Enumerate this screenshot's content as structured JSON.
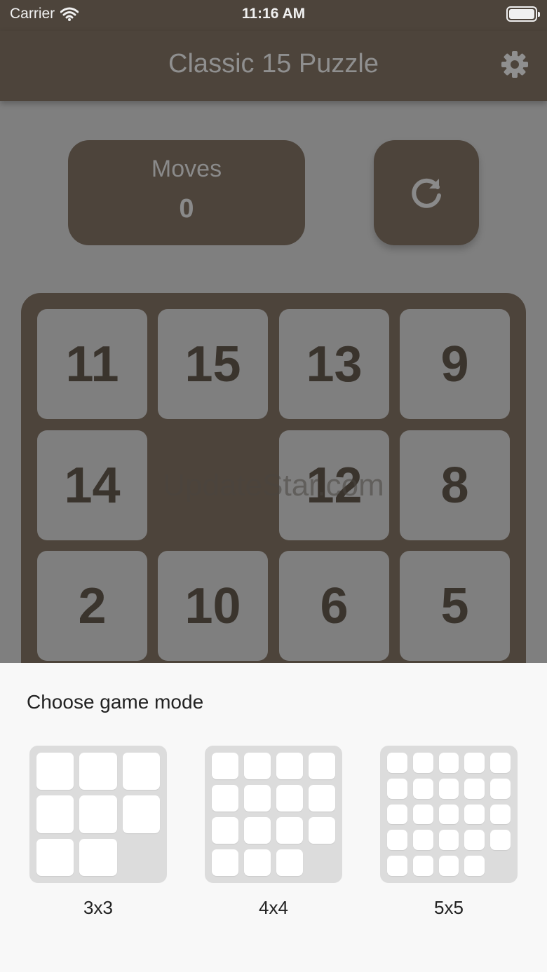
{
  "status_bar": {
    "carrier": "Carrier",
    "time": "11:16 AM"
  },
  "nav": {
    "title": "Classic 15 Puzzle",
    "settings_icon": "gear-icon"
  },
  "stats": {
    "moves_label": "Moves",
    "moves_value": "0",
    "reset_icon": "refresh-icon"
  },
  "board": {
    "rows": [
      [
        "11",
        "15",
        "13",
        "9"
      ],
      [
        "14",
        "",
        "12",
        "8"
      ],
      [
        "2",
        "10",
        "6",
        "5"
      ]
    ]
  },
  "watermark": "UpdateStar.com",
  "sheet": {
    "title": "Choose game mode",
    "modes": [
      {
        "label": "3x3",
        "size": 3
      },
      {
        "label": "4x4",
        "size": 4
      },
      {
        "label": "5x5",
        "size": 5
      }
    ]
  },
  "colors": {
    "brand_dark": "#4d443b",
    "overlay_gray": "#7f7f7f",
    "sheet_bg": "#f8f8f8"
  }
}
